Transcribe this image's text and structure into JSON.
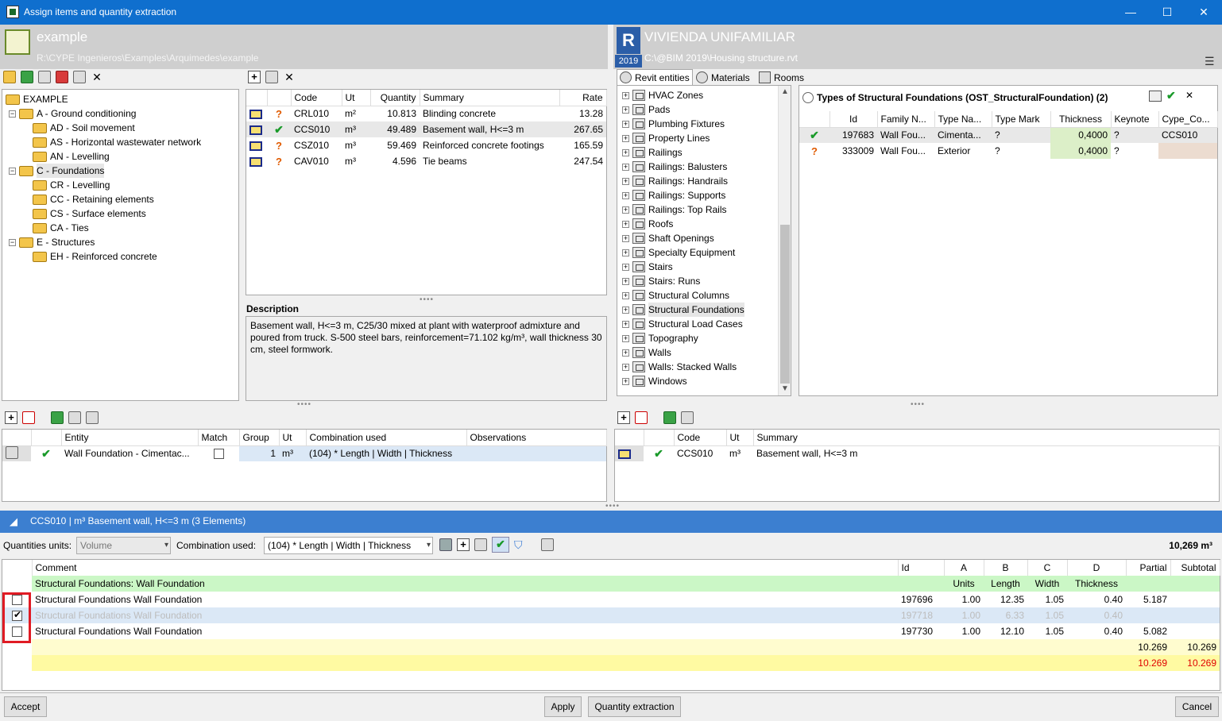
{
  "window": {
    "title": "Assign items and quantity extraction",
    "minimize": "—",
    "maximize": "☐",
    "close": "✕"
  },
  "left_project": {
    "name": "example",
    "path": "R:\\CYPE Ingenieros\\Examples\\Arquimedes\\example"
  },
  "right_project": {
    "name": "VIVIENDA UNIFAMILIAR",
    "year": "2019",
    "path": "C:\\@BIM 2019\\Housing structure.rvt",
    "logo": "R"
  },
  "chapter_tree": [
    {
      "label": "EXAMPLE",
      "level": 0
    },
    {
      "label": "A - Ground conditioning",
      "level": 1
    },
    {
      "label": "AD - Soil movement",
      "level": 2
    },
    {
      "label": "AS - Horizontal wastewater network",
      "level": 2
    },
    {
      "label": "AN - Levelling",
      "level": 2
    },
    {
      "label": "C - Foundations",
      "level": 1
    },
    {
      "label": "CR - Levelling",
      "level": 2
    },
    {
      "label": "CC - Retaining elements",
      "level": 2
    },
    {
      "label": "CS - Surface elements",
      "level": 2
    },
    {
      "label": "CA - Ties",
      "level": 2
    },
    {
      "label": "E - Structures",
      "level": 1
    },
    {
      "label": "EH - Reinforced concrete",
      "level": 2
    }
  ],
  "items_table": {
    "headers": [
      "Code",
      "Ut",
      "Quantity",
      "Summary",
      "Rate"
    ],
    "rows": [
      {
        "status": "?",
        "code": "CRL010",
        "ut": "m²",
        "quantity": "10.813",
        "summary": "Blinding concrete",
        "rate": "13.28"
      },
      {
        "status": "✔",
        "code": "CCS010",
        "ut": "m³",
        "quantity": "49.489",
        "summary": "Basement wall, H<=3 m",
        "rate": "267.65"
      },
      {
        "status": "?",
        "code": "CSZ010",
        "ut": "m³",
        "quantity": "59.469",
        "summary": "Reinforced concrete footings",
        "rate": "165.59"
      },
      {
        "status": "?",
        "code": "CAV010",
        "ut": "m³",
        "quantity": "4.596",
        "summary": "Tie beams",
        "rate": "247.54"
      }
    ]
  },
  "description": {
    "label": "Description",
    "text": "Basement wall, H<=3 m, C25/30 mixed at plant with waterproof admixture and poured from truck. S-500 steel bars, reinforcement=71.102 kg/m³, wall thickness 30 cm, steel formwork."
  },
  "revit_tabs": [
    "Revit entities",
    "Materials",
    "Rooms"
  ],
  "revit_tree": [
    "HVAC Zones",
    "Pads",
    "Plumbing Fixtures",
    "Property Lines",
    "Railings",
    "Railings: Balusters",
    "Railings: Handrails",
    "Railings: Supports",
    "Railings: Top Rails",
    "Roofs",
    "Shaft Openings",
    "Specialty Equipment",
    "Stairs",
    "Stairs: Runs",
    "Structural Columns",
    "Structural Foundations",
    "Structural Load Cases",
    "Topography",
    "Walls",
    "Walls: Stacked Walls",
    "Windows"
  ],
  "types_panel": {
    "title": "Types of Structural Foundations (OST_StructuralFoundation) (2)",
    "headers": [
      "Id",
      "Family N...",
      "Type Na...",
      "Type Mark",
      "Thickness",
      "Keynote",
      "Cype_Co..."
    ],
    "rows": [
      {
        "status": "✔",
        "id": "197683",
        "family": "Wall Fou...",
        "type": "Cimenta...",
        "mark": "?",
        "thickness": "0,4000",
        "keynote": "?",
        "cype": "CCS010"
      },
      {
        "status": "?",
        "id": "333009",
        "family": "Wall Fou...",
        "type": "Exterior",
        "mark": "?",
        "thickness": "0,4000",
        "keynote": "?",
        "cype": ""
      }
    ]
  },
  "assign_table": {
    "headers": [
      "Entity",
      "Match",
      "Group",
      "Ut",
      "Combination used",
      "Observations"
    ],
    "rows": [
      {
        "entity": "Wall Foundation - Cimentac...",
        "group": "1",
        "ut": "m³",
        "combination": "(104) * Length | Width | Thickness",
        "observations": ""
      }
    ]
  },
  "assigned_items": {
    "headers": [
      "Code",
      "Ut",
      "Summary"
    ],
    "rows": [
      {
        "code": "CCS010",
        "ut": "m³",
        "summary": "Basement wall, H<=3 m"
      }
    ]
  },
  "bottom_bar": {
    "title": "CCS010 | m³ Basement wall, H<=3 m (3 Elements)"
  },
  "qty_toolbar": {
    "units_label": "Quantities units:",
    "units_value": "Volume",
    "combo_label": "Combination used:",
    "combo_value": "(104) * Length | Width | Thickness",
    "total": "10,269 m³"
  },
  "measure_table": {
    "headers": [
      "Comment",
      "Id",
      "A",
      "B",
      "C",
      "D",
      "Partial",
      "Subtotal"
    ],
    "group_row": {
      "comment": "Structural Foundations: Wall Foundation",
      "a": "Units",
      "b": "Length",
      "c": "Width",
      "d": "Thickness"
    },
    "rows": [
      {
        "checked": false,
        "comment": "Structural Foundations Wall Foundation",
        "id": "197696",
        "a": "1.00",
        "b": "12.35",
        "c": "1.05",
        "d": "0.40",
        "partial": "5.187",
        "disabled": false
      },
      {
        "checked": true,
        "comment": "Structural Foundations Wall Foundation",
        "id": "197718",
        "a": "1.00",
        "b": "6.33",
        "c": "1.05",
        "d": "0.40",
        "partial": "",
        "disabled": true
      },
      {
        "checked": false,
        "comment": "Structural Foundations Wall Foundation",
        "id": "197730",
        "a": "1.00",
        "b": "12.10",
        "c": "1.05",
        "d": "0.40",
        "partial": "5.082",
        "disabled": false
      }
    ],
    "sum1": {
      "partial": "10.269",
      "subtotal": "10.269"
    },
    "sum2": {
      "partial": "10.269",
      "subtotal": "10.269"
    }
  },
  "buttons": {
    "accept": "Accept",
    "apply": "Apply",
    "quantity_extraction": "Quantity extraction",
    "cancel": "Cancel"
  },
  "colors": {
    "title_bar": "#0f6fce",
    "blue_bar": "#3c7fd0",
    "selected_row": "#dbe8f6",
    "green_row": "#cbf7c6",
    "yellow_row": "#fffaa2",
    "highlight_box": "#e01b24"
  }
}
